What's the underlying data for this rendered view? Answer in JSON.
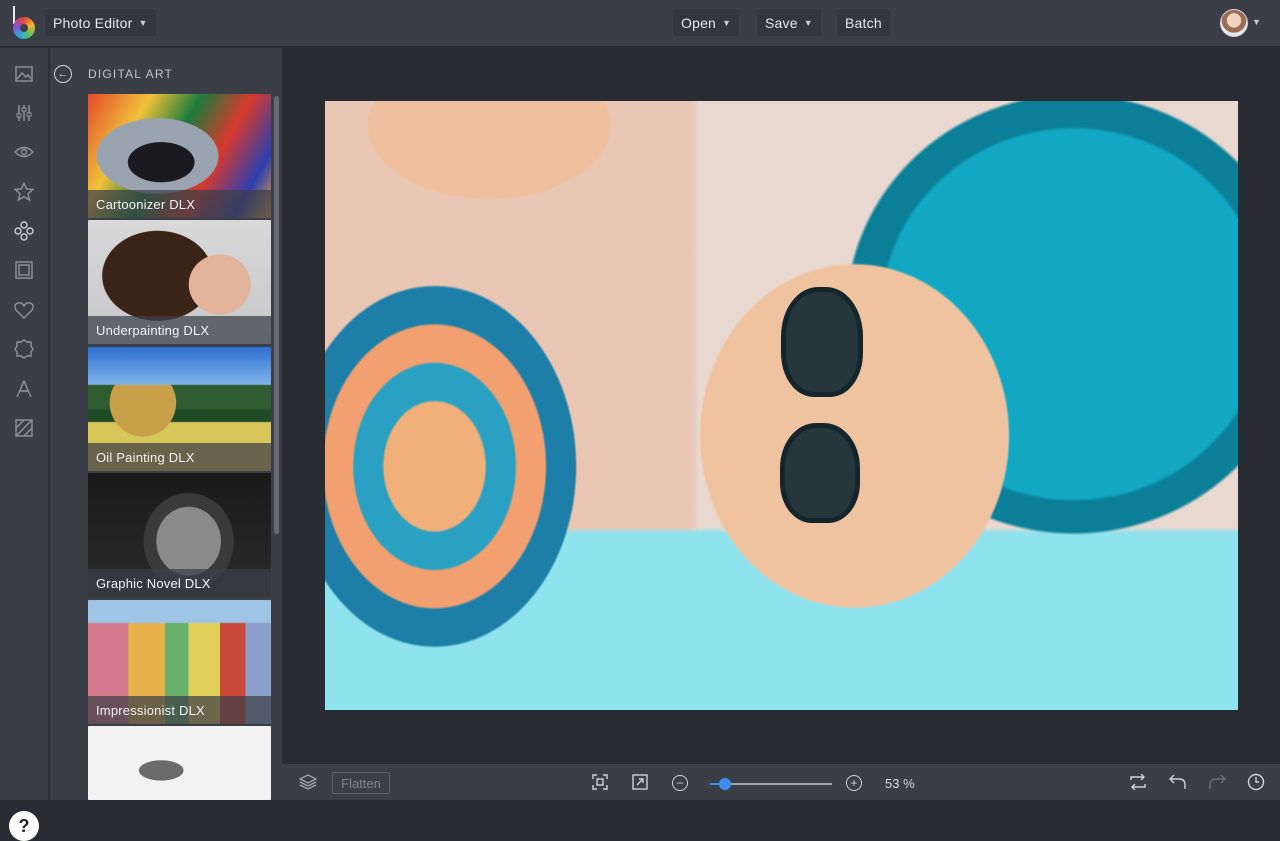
{
  "topbar": {
    "app_switcher_label": "Photo Editor",
    "open_label": "Open",
    "save_label": "Save",
    "batch_label": "Batch"
  },
  "rail": {
    "icons": [
      "image-icon",
      "sliders-icon",
      "eye-icon",
      "star-icon",
      "effects-icon",
      "frame-icon",
      "heart-icon",
      "badge-icon",
      "text-icon",
      "texture-icon"
    ],
    "help_label": "?"
  },
  "panel": {
    "title": "DIGITAL ART",
    "effects": [
      {
        "label": "Cartoonizer DLX"
      },
      {
        "label": "Underpainting DLX"
      },
      {
        "label": "Oil Painting DLX"
      },
      {
        "label": "Graphic Novel DLX"
      },
      {
        "label": "Impressionist DLX"
      },
      {
        "label": ""
      }
    ]
  },
  "bottombar": {
    "flatten_label": "Flatten",
    "zoom_percent": 53,
    "zoom_label": "53 %",
    "zoom_level_fraction": 0.12
  }
}
